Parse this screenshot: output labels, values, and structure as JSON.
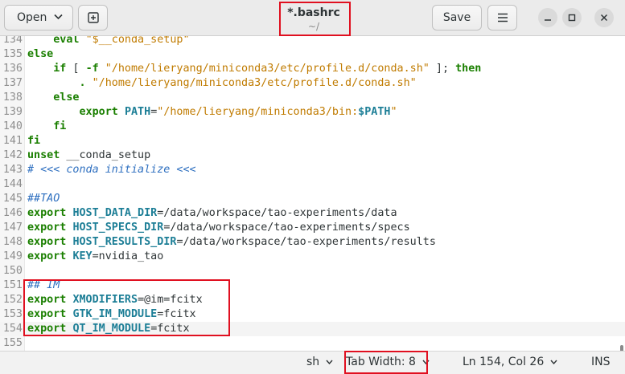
{
  "header": {
    "open_label": "Open",
    "save_label": "Save",
    "title": "*.bashrc",
    "subtitle": "~/"
  },
  "editor": {
    "lines": [
      {
        "num": "134",
        "segs": [
          {
            "t": "    ",
            "c": ""
          },
          {
            "t": "eval",
            "c": "kw"
          },
          {
            "t": " ",
            "c": ""
          },
          {
            "t": "\"$__conda_setup\"",
            "c": "str"
          }
        ]
      },
      {
        "num": "135",
        "segs": [
          {
            "t": "else",
            "c": "kw"
          }
        ]
      },
      {
        "num": "136",
        "segs": [
          {
            "t": "    ",
            "c": ""
          },
          {
            "t": "if",
            "c": "kw"
          },
          {
            "t": " [ ",
            "c": ""
          },
          {
            "t": "-f",
            "c": "kw"
          },
          {
            "t": " ",
            "c": ""
          },
          {
            "t": "\"/home/lieryang/miniconda3/etc/profile.d/conda.sh\"",
            "c": "str"
          },
          {
            "t": " ]; ",
            "c": ""
          },
          {
            "t": "then",
            "c": "kw"
          }
        ]
      },
      {
        "num": "137",
        "segs": [
          {
            "t": "        ",
            "c": ""
          },
          {
            "t": ".",
            "c": "kw"
          },
          {
            "t": " ",
            "c": ""
          },
          {
            "t": "\"/home/lieryang/miniconda3/etc/profile.d/conda.sh\"",
            "c": "str"
          }
        ]
      },
      {
        "num": "138",
        "segs": [
          {
            "t": "    ",
            "c": ""
          },
          {
            "t": "else",
            "c": "kw"
          }
        ]
      },
      {
        "num": "139",
        "segs": [
          {
            "t": "        ",
            "c": ""
          },
          {
            "t": "export",
            "c": "kw"
          },
          {
            "t": " ",
            "c": ""
          },
          {
            "t": "PATH",
            "c": "var"
          },
          {
            "t": "=",
            "c": ""
          },
          {
            "t": "\"/home/lieryang/miniconda3/bin:",
            "c": "str"
          },
          {
            "t": "$PATH",
            "c": "var"
          },
          {
            "t": "\"",
            "c": "str"
          }
        ]
      },
      {
        "num": "140",
        "segs": [
          {
            "t": "    ",
            "c": ""
          },
          {
            "t": "fi",
            "c": "kw"
          }
        ]
      },
      {
        "num": "141",
        "segs": [
          {
            "t": "fi",
            "c": "kw"
          }
        ]
      },
      {
        "num": "142",
        "segs": [
          {
            "t": "unset",
            "c": "kw"
          },
          {
            "t": " __conda_setup",
            "c": ""
          }
        ]
      },
      {
        "num": "143",
        "segs": [
          {
            "t": "# <<< conda initialize <<<",
            "c": "com"
          }
        ]
      },
      {
        "num": "144",
        "segs": []
      },
      {
        "num": "145",
        "segs": [
          {
            "t": "##TAO",
            "c": "com"
          }
        ]
      },
      {
        "num": "146",
        "segs": [
          {
            "t": "export",
            "c": "kw"
          },
          {
            "t": " ",
            "c": ""
          },
          {
            "t": "HOST_DATA_DIR",
            "c": "var"
          },
          {
            "t": "=/data/workspace/tao-experiments/data",
            "c": ""
          }
        ]
      },
      {
        "num": "147",
        "segs": [
          {
            "t": "export",
            "c": "kw"
          },
          {
            "t": " ",
            "c": ""
          },
          {
            "t": "HOST_SPECS_DIR",
            "c": "var"
          },
          {
            "t": "=/data/workspace/tao-experiments/specs",
            "c": ""
          }
        ]
      },
      {
        "num": "148",
        "segs": [
          {
            "t": "export",
            "c": "kw"
          },
          {
            "t": " ",
            "c": ""
          },
          {
            "t": "HOST_RESULTS_DIR",
            "c": "var"
          },
          {
            "t": "=/data/workspace/tao-experiments/results",
            "c": ""
          }
        ]
      },
      {
        "num": "149",
        "segs": [
          {
            "t": "export",
            "c": "kw"
          },
          {
            "t": " ",
            "c": ""
          },
          {
            "t": "KEY",
            "c": "var"
          },
          {
            "t": "=nvidia_tao",
            "c": ""
          }
        ]
      },
      {
        "num": "150",
        "segs": []
      },
      {
        "num": "151",
        "segs": [
          {
            "t": "## IM",
            "c": "com"
          }
        ]
      },
      {
        "num": "152",
        "segs": [
          {
            "t": "export",
            "c": "kw"
          },
          {
            "t": " ",
            "c": ""
          },
          {
            "t": "XMODIFIERS",
            "c": "var"
          },
          {
            "t": "=@im=fcitx",
            "c": ""
          }
        ]
      },
      {
        "num": "153",
        "segs": [
          {
            "t": "export",
            "c": "kw"
          },
          {
            "t": " ",
            "c": ""
          },
          {
            "t": "GTK_IM_MODULE",
            "c": "var"
          },
          {
            "t": "=fcitx",
            "c": ""
          }
        ]
      },
      {
        "num": "154",
        "segs": [
          {
            "t": "export",
            "c": "kw"
          },
          {
            "t": " ",
            "c": ""
          },
          {
            "t": "QT_IM_MODULE",
            "c": "var"
          },
          {
            "t": "=fcitx",
            "c": ""
          }
        ]
      },
      {
        "num": "155",
        "segs": []
      }
    ],
    "current_line": "154"
  },
  "statusbar": {
    "language": "sh",
    "tab_width": "Tab Width: 8",
    "position": "Ln 154, Col 26",
    "mode": "INS"
  },
  "icons": {
    "new_tab": "new-tab-icon",
    "menu": "hamburger-menu-icon",
    "minimize": "minimize-icon",
    "maximize": "maximize-icon",
    "close": "close-icon"
  },
  "colors": {
    "annotation": "#e01020",
    "keyword": "#1a7f00",
    "string": "#c07b00",
    "variable": "#1c7e96",
    "comment": "#2f70c0"
  }
}
